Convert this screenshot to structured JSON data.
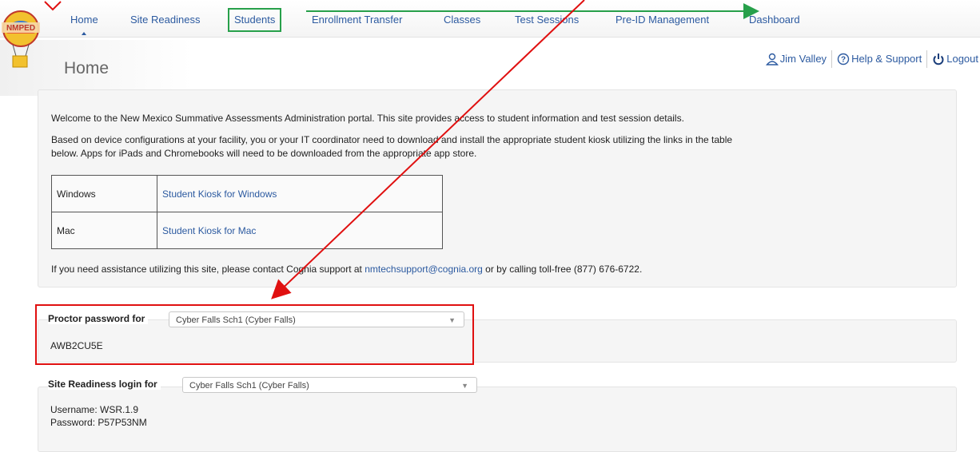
{
  "nav": {
    "items": [
      {
        "label": "Home"
      },
      {
        "label": "Site Readiness"
      },
      {
        "label": "Students"
      },
      {
        "label": "Enrollment Transfer"
      },
      {
        "label": "Classes"
      },
      {
        "label": "Test Sessions"
      },
      {
        "label": "Pre-ID Management"
      },
      {
        "label": "Dashboard"
      }
    ],
    "logo_text": "NMPED"
  },
  "page": {
    "title": "Home"
  },
  "userbar": {
    "user": "Jim Valley",
    "help": "Help & Support",
    "logout": "Logout"
  },
  "welcome": {
    "p1": "Welcome to the New Mexico Summative Assessments Administration portal. This site provides access to student information and test session details.",
    "p2a": "Based on device configurations at your facility, you or your IT coordinator need to download and install the appropriate student kiosk utilizing the links in the table",
    "p2b": "below. Apps for iPads and Chromebooks will need to be downloaded from the appropriate app store.",
    "kiosk": [
      {
        "os": "Windows",
        "link": "Student Kiosk for Windows"
      },
      {
        "os": "Mac",
        "link": "Student Kiosk for Mac"
      }
    ],
    "p3a": "If you need assistance utilizing this site, please contact Cognia support at ",
    "email": "nmtechsupport@cognia.org",
    "p3b": " or by calling toll-free (877) 676-6722."
  },
  "proctor": {
    "label": "Proctor password for",
    "select": "Cyber Falls Sch1 (Cyber Falls)",
    "password": "AWB2CU5E"
  },
  "readiness": {
    "label": "Site Readiness login for",
    "select": "Cyber Falls Sch1 (Cyber Falls)",
    "username": "Username: WSR.1.9",
    "password": "Password: P57P53NM"
  },
  "colors": {
    "link": "#2c5aa0",
    "annotation_red": "#e01010",
    "annotation_green": "#27a04a"
  },
  "icons": [
    "user-icon",
    "help-circle-icon",
    "power-icon",
    "logo-balloon-icon",
    "select-caret-icon"
  ]
}
